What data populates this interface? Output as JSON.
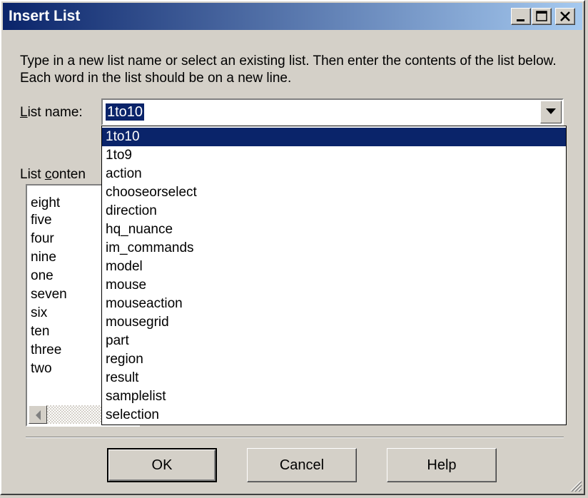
{
  "window": {
    "title": "Insert List"
  },
  "instructions": "Type in a new list name or select an existing list. Then enter the contents of the list below. Each word in the list should be on a new line.",
  "list_name": {
    "label_accel": "L",
    "label_rest": "ist name:",
    "value": "1to10"
  },
  "list_contents": {
    "label_pre": "List ",
    "label_accel": "c",
    "label_rest": "onten",
    "lines": [
      "eight",
      "five",
      "four",
      "nine",
      "one",
      "seven",
      "six",
      "ten",
      "three",
      "two"
    ]
  },
  "dropdown": {
    "selected": "1to10",
    "options": [
      "1to10",
      "1to9",
      "action",
      "chooseorselect",
      "direction",
      "hq_nuance",
      "im_commands",
      "model",
      "mouse",
      "mouseaction",
      "mousegrid",
      "part",
      "region",
      "result",
      "samplelist",
      "selection"
    ]
  },
  "buttons": {
    "ok": "OK",
    "cancel": "Cancel",
    "help": "Help"
  },
  "colors": {
    "title_start": "#0a246a",
    "title_end": "#a6caf0",
    "selection": "#0a246a",
    "face": "#d4d0c8"
  },
  "icons": {
    "minimize": "minimize-icon",
    "maximize": "maximize-icon",
    "close": "close-icon",
    "dropdown_arrow": "chevron-down-icon",
    "scroll_left": "arrow-left-icon",
    "resize_grip": "resize-grip-icon"
  }
}
